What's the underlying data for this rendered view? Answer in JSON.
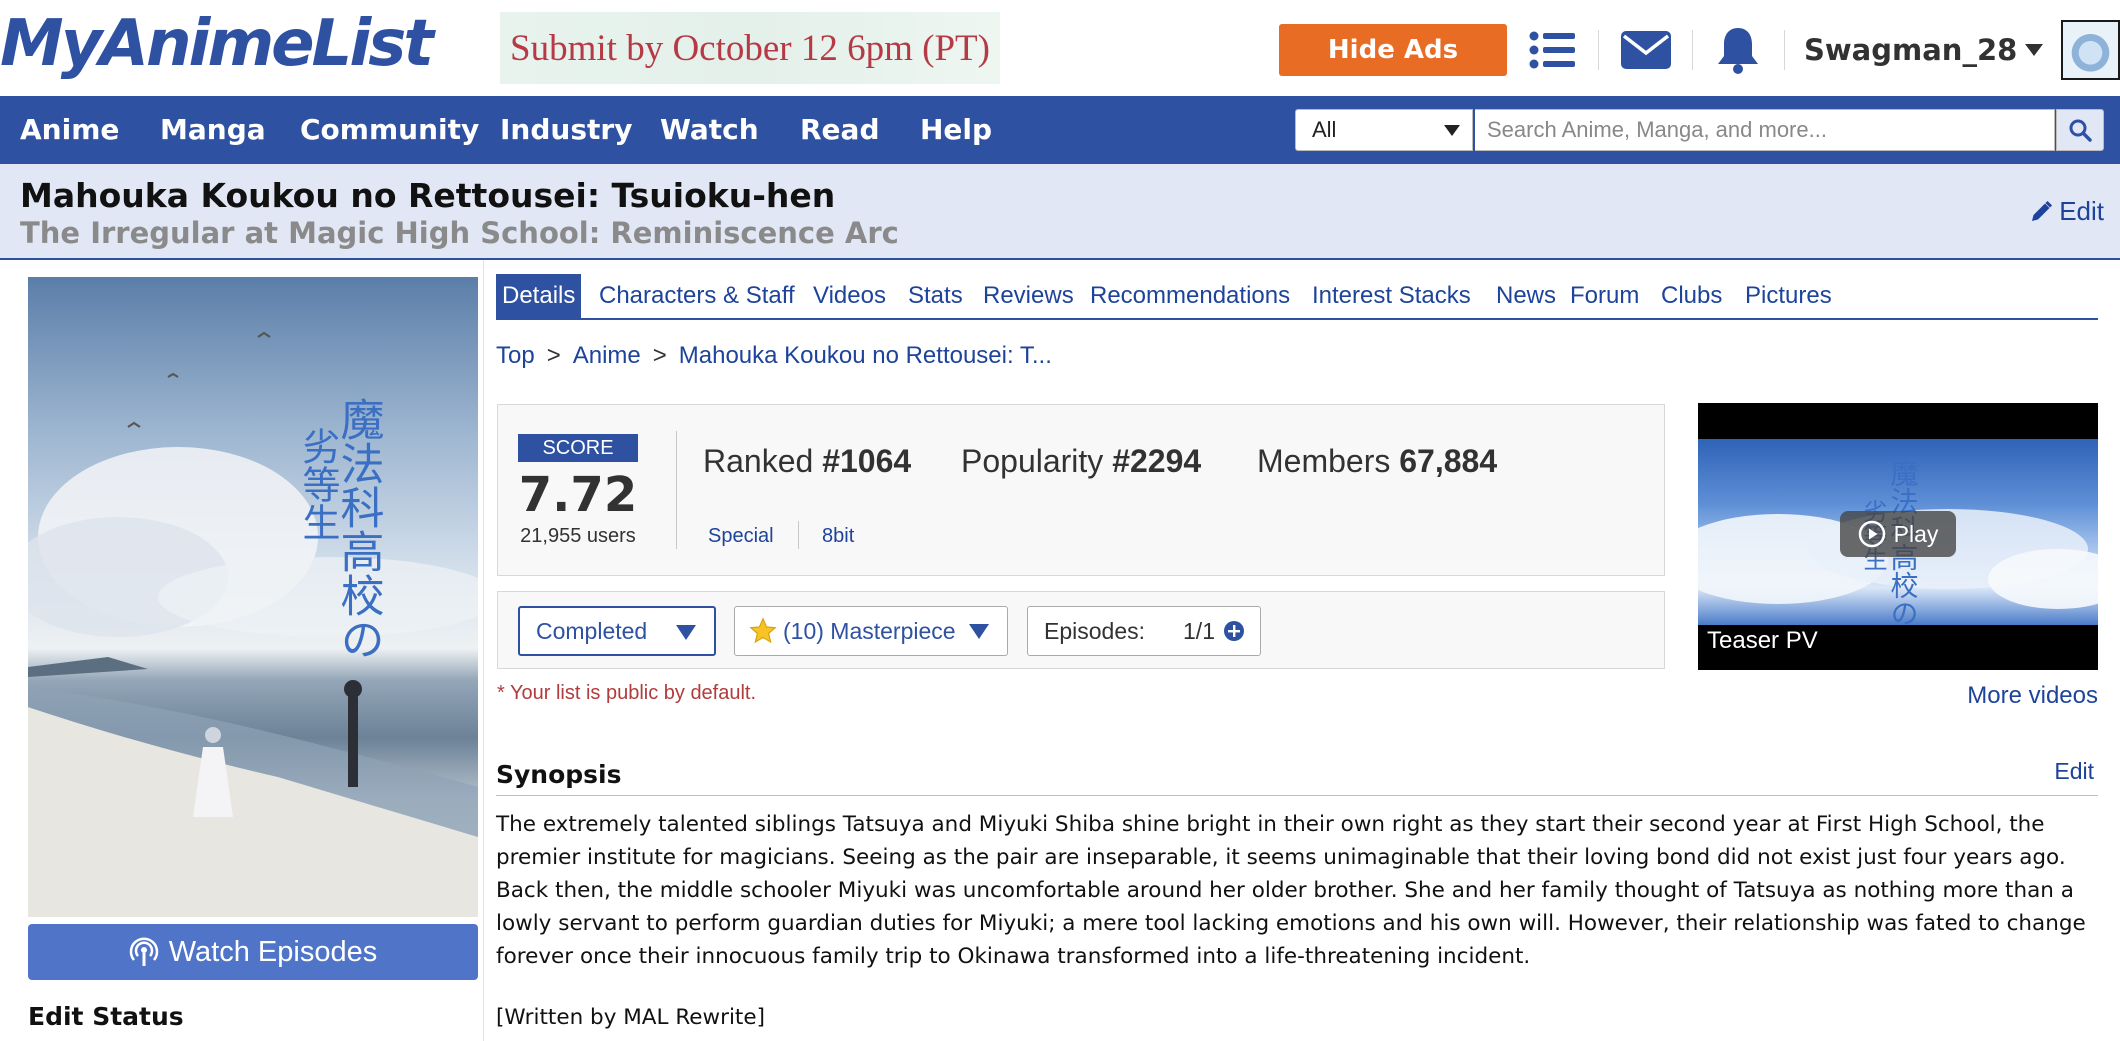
{
  "header": {
    "logo_text": "MyAnimeList",
    "banner_text": "Submit by October 12 6pm (PT)",
    "hide_ads_label": "Hide Ads",
    "username": "Swagman_28",
    "icons": [
      "list-icon",
      "mail-icon",
      "bell-icon"
    ]
  },
  "nav": {
    "items": [
      {
        "label": "Anime"
      },
      {
        "label": "Manga"
      },
      {
        "label": "Community"
      },
      {
        "label": "Industry"
      },
      {
        "label": "Watch"
      },
      {
        "label": "Read"
      },
      {
        "label": "Help"
      }
    ],
    "search_type": "All",
    "search_placeholder": "Search Anime, Manga, and more..."
  },
  "title": {
    "main": "Mahouka Koukou no Rettousei: Tsuioku-hen",
    "english": "The Irregular at Magic High School: Reminiscence Arc",
    "edit_label": "Edit"
  },
  "sidebar": {
    "watch_label": "Watch Episodes",
    "edit_status_title": "Edit Status"
  },
  "tabs": [
    {
      "label": "Details",
      "active": true
    },
    {
      "label": "Characters & Staff"
    },
    {
      "label": "Videos"
    },
    {
      "label": "Stats"
    },
    {
      "label": "Reviews"
    },
    {
      "label": "Recommendations"
    },
    {
      "label": "Interest Stacks"
    },
    {
      "label": "News"
    },
    {
      "label": "Forum"
    },
    {
      "label": "Clubs"
    },
    {
      "label": "Pictures"
    }
  ],
  "breadcrumb": {
    "items": [
      "Top",
      "Anime",
      "Mahouka Koukou no Rettousei: T..."
    ],
    "separator": ">"
  },
  "stats": {
    "score_label": "SCORE",
    "score": "7.72",
    "score_users": "21,955 users",
    "ranked_label": "Ranked",
    "ranked_value": "#1064",
    "popularity_label": "Popularity",
    "popularity_value": "#2294",
    "members_label": "Members",
    "members_value": "67,884",
    "type": "Special",
    "studio": "8bit"
  },
  "list": {
    "status": "Completed",
    "score": "(10) Masterpiece",
    "episodes_label": "Episodes:",
    "episodes_value": "1/1",
    "note": "* Your list is public by default."
  },
  "video": {
    "play_label": "Play",
    "title": "Teaser PV",
    "more_label": "More videos"
  },
  "synopsis": {
    "title": "Synopsis",
    "edit_label": "Edit",
    "text": "The extremely talented siblings Tatsuya and Miyuki Shiba shine bright in their own right as they start their second year at First High School, the premier institute for magicians. Seeing as the pair are inseparable, it seems unimaginable that their loving bond did not exist just four years ago. Back then, the middle schooler Miyuki was uncomfortable around her older brother. She and her family thought of Tatsuya as nothing more than a lowly servant to perform guardian duties for Miyuki; a mere tool lacking emotions and his own will. However, their relationship was fated to change forever once their innocuous family trip to Okinawa transformed into a life-threatening incident.",
    "credit": "[Written by MAL Rewrite]"
  },
  "colors": {
    "brand_blue": "#2e51a2",
    "accent_orange": "#e86c24",
    "link_blue": "#1d439b",
    "title_bar_bg": "#e1e7f5",
    "note_red": "#b23b3b"
  }
}
